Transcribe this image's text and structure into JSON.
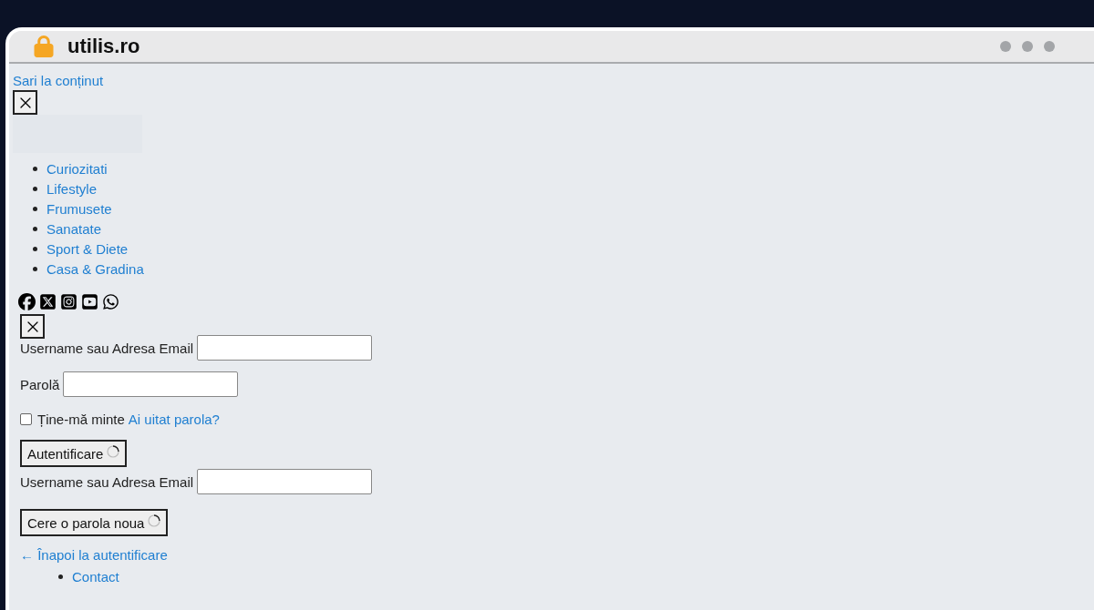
{
  "browser": {
    "domain": "utilis.ro"
  },
  "skip_link": "Sari la conținut",
  "menu": {
    "items": [
      {
        "label": "Curiozitati"
      },
      {
        "label": "Lifestyle"
      },
      {
        "label": "Frumusete"
      },
      {
        "label": "Sanatate"
      },
      {
        "label": "Sport & Diete"
      },
      {
        "label": "Casa & Gradina"
      }
    ]
  },
  "social": [
    {
      "kind": "facebook"
    },
    {
      "kind": "x"
    },
    {
      "kind": "instagram"
    },
    {
      "kind": "youtube"
    },
    {
      "kind": "whatsapp"
    }
  ],
  "login_form": {
    "username_label": "Username sau Adresa Email",
    "password_label": "Parolă",
    "remember": {
      "label": "Ține-mă minte",
      "checked": false
    },
    "forgot_link": "Ai uitat parola?",
    "submit": "Autentificare"
  },
  "reset_form": {
    "username_label": "Username sau Adresa Email",
    "submit": "Cere o parola noua",
    "back_link": "← Înapoi la autentificare"
  },
  "footer_menu": [
    {
      "label": "Contact"
    }
  ]
}
